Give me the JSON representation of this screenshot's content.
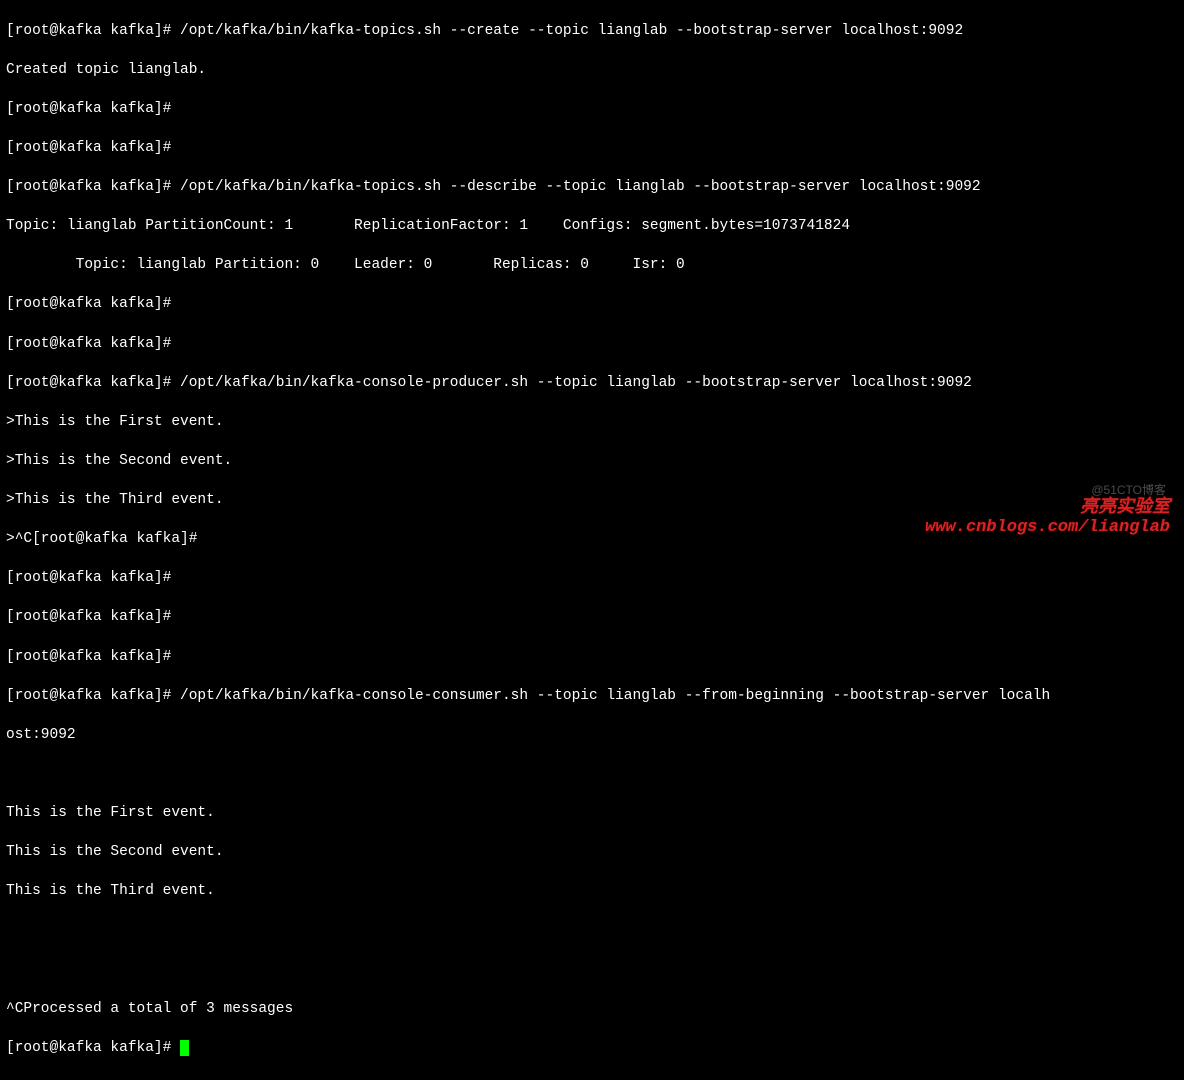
{
  "prompt": "[root@kafka kafka]#",
  "lines": {
    "l00": "[root@kafka kafka]# /opt/kafka/bin/kafka-topics.sh --create --topic lianglab --bootstrap-server localhost:9092",
    "l01": "Created topic lianglab.",
    "l02": "[root@kafka kafka]#",
    "l03": "[root@kafka kafka]#",
    "l04": "[root@kafka kafka]# /opt/kafka/bin/kafka-topics.sh --describe --topic lianglab --bootstrap-server localhost:9092",
    "l05": "Topic: lianglab PartitionCount: 1       ReplicationFactor: 1    Configs: segment.bytes=1073741824",
    "l06": "        Topic: lianglab Partition: 0    Leader: 0       Replicas: 0     Isr: 0",
    "l07": "[root@kafka kafka]#",
    "l08": "[root@kafka kafka]#",
    "l09": "[root@kafka kafka]# /opt/kafka/bin/kafka-console-producer.sh --topic lianglab --bootstrap-server localhost:9092",
    "l10": ">This is the First event.",
    "l11": ">This is the Second event.",
    "l12": ">This is the Third event.",
    "l13": ">^C[root@kafka kafka]#",
    "l14": "[root@kafka kafka]#",
    "l15": "[root@kafka kafka]#",
    "l16": "[root@kafka kafka]#",
    "l17": "[root@kafka kafka]# /opt/kafka/bin/kafka-console-consumer.sh --topic lianglab --from-beginning --bootstrap-server localh",
    "l18": "ost:9092",
    "l19": "",
    "l20": "This is the First event.",
    "l21": "This is the Second event.",
    "l22": "This is the Third event.",
    "l23": "",
    "l24": "",
    "l25": "^CProcessed a total of 3 messages",
    "l26": "[root@kafka kafka]# "
  },
  "watermarks": {
    "wm_small": "@51CTO博客",
    "wm_cn": "亮亮实验室",
    "wm_url": "www.cnblogs.com/lianglab"
  }
}
